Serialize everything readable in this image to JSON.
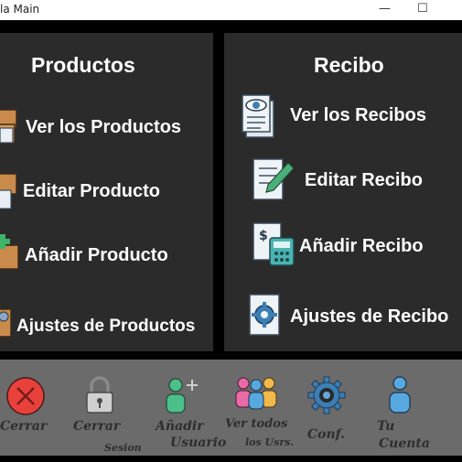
{
  "window": {
    "title": "la Main",
    "minimize_glyph": "—",
    "maximize_glyph": "☐"
  },
  "productos": {
    "title": "Productos",
    "items": [
      {
        "label": "Ver los Productos",
        "icon": "boxes-document-icon"
      },
      {
        "label": "Editar Producto",
        "icon": "box-edit-icon"
      },
      {
        "label": "Añadir Producto",
        "icon": "box-add-icon"
      },
      {
        "label": "Ajustes de Productos",
        "icon": "box-settings-icon"
      }
    ]
  },
  "recibo": {
    "title": "Recibo",
    "items": [
      {
        "label": "Ver los Recibos",
        "icon": "receipt-eye-icon"
      },
      {
        "label": "Editar Recibo",
        "icon": "receipt-pencil-icon"
      },
      {
        "label": "Añadir Recibo",
        "icon": "receipt-calculator-icon"
      },
      {
        "label": "Ajustes de Recibo",
        "icon": "receipt-gear-icon"
      }
    ]
  },
  "bottom_bar": {
    "buttons": [
      {
        "label": "Cerrar",
        "icon": "close-circle-icon"
      },
      {
        "label": "Cerrar",
        "sub": "Sesion",
        "icon": "padlock-icon"
      },
      {
        "label": "Añadir",
        "sub": "Usuario",
        "icon": "add-user-icon"
      },
      {
        "label": "Ver todos",
        "sub": "los Usrs.",
        "icon": "users-group-icon"
      },
      {
        "label": "Conf.",
        "icon": "gear-icon"
      },
      {
        "label": "Tu",
        "sub": "Cuenta",
        "icon": "user-account-icon"
      }
    ]
  },
  "colors": {
    "background": "#000000",
    "panel": "#2b2b2b",
    "bottom_bar": "#6b6b6b",
    "text": "#ffffff",
    "close_red": "#e8413c"
  }
}
